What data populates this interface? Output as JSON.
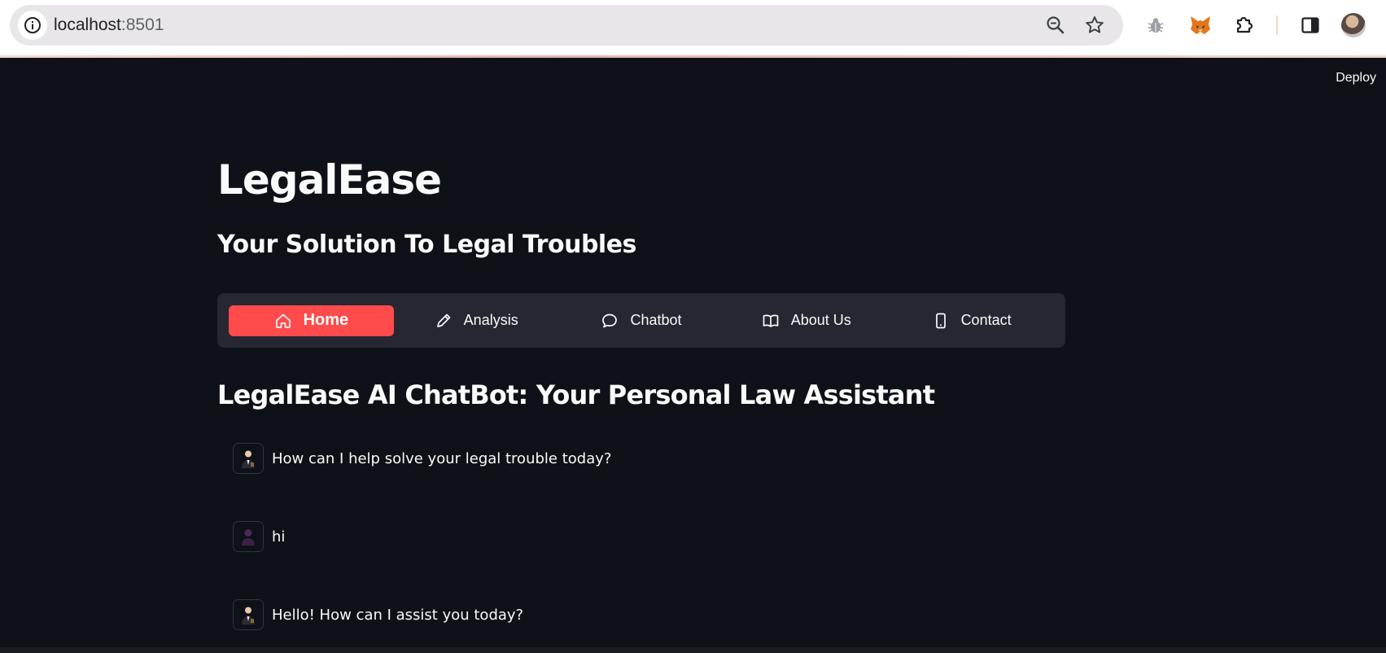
{
  "browser": {
    "url_host": "localhost",
    "url_port": ":8501"
  },
  "header": {
    "deploy_label": "Deploy"
  },
  "page": {
    "title": "LegalEase",
    "subtitle": "Your Solution To Legal Troubles"
  },
  "nav": {
    "items": [
      {
        "label": "Home",
        "icon": "house-icon",
        "active": true
      },
      {
        "label": "Analysis",
        "icon": "pencil-icon",
        "active": false
      },
      {
        "label": "Chatbot",
        "icon": "chat-bubble-icon",
        "active": false
      },
      {
        "label": "About Us",
        "icon": "book-icon",
        "active": false
      },
      {
        "label": "Contact",
        "icon": "phone-icon",
        "active": false
      }
    ],
    "active_color": "#ff4b4b"
  },
  "chat": {
    "heading": "LegalEase AI ChatBot: Your Personal Law Assistant",
    "messages": [
      {
        "role": "assistant",
        "avatar": "lawyer-avatar-icon",
        "text": "How can I help solve your legal trouble today?"
      },
      {
        "role": "user",
        "avatar": "user-avatar-icon",
        "text": "hi"
      },
      {
        "role": "assistant",
        "avatar": "lawyer-avatar-icon",
        "text": "Hello! How can I assist you today?"
      }
    ]
  },
  "colors": {
    "background": "#0e1117",
    "nav_background": "#262730",
    "text": "#fafafa"
  }
}
